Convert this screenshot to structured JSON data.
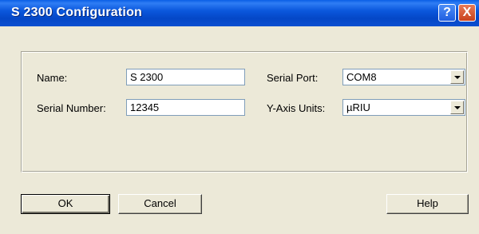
{
  "window": {
    "title": "S 2300 Configuration"
  },
  "titlebar_buttons": {
    "help": "?",
    "close": "X"
  },
  "form": {
    "name": {
      "label": "Name:",
      "value": "S 2300"
    },
    "serial_number": {
      "label": "Serial Number:",
      "value": "12345"
    },
    "serial_port": {
      "label": "Serial Port:",
      "value": "COM8"
    },
    "y_axis_units": {
      "label": "Y-Axis Units:",
      "value": "µRIU"
    }
  },
  "buttons": {
    "ok": "OK",
    "cancel": "Cancel",
    "help": "Help"
  },
  "colors": {
    "titlebar": "#0b58dd",
    "dialog_bg": "#ece9d8",
    "close": "#c9421c"
  },
  "icons": {
    "help": "question-mark-icon",
    "close": "close-x-icon",
    "dropdown": "chevron-down-icon"
  }
}
